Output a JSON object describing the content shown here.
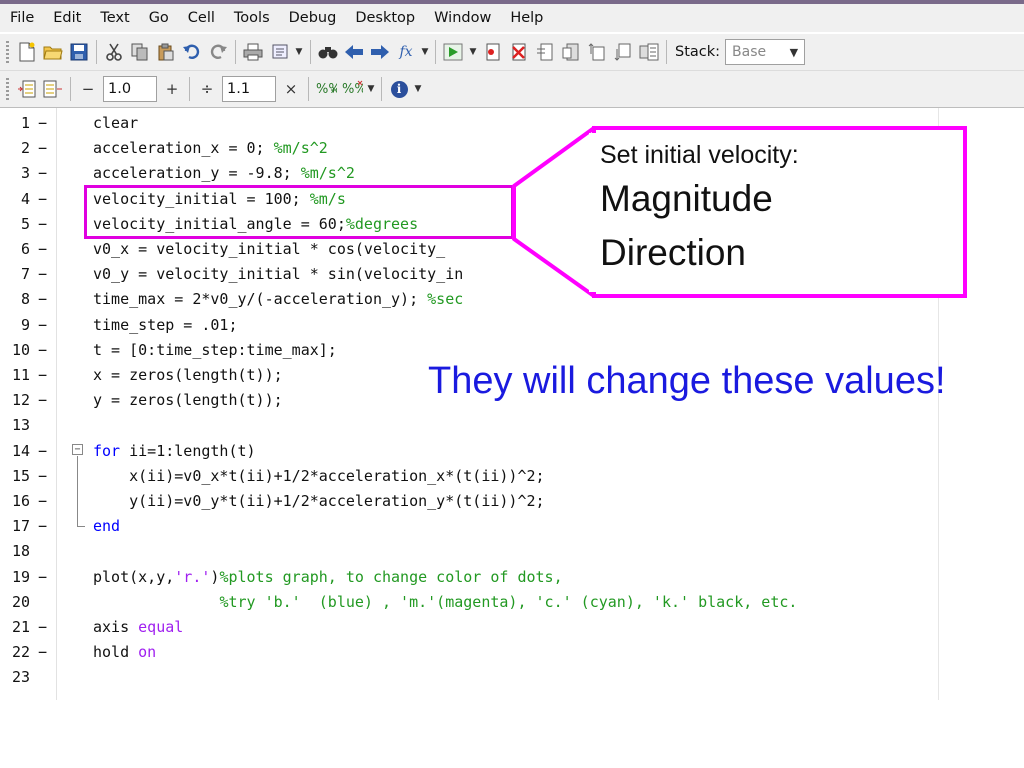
{
  "menu": [
    "File",
    "Edit",
    "Text",
    "Go",
    "Cell",
    "Tools",
    "Debug",
    "Desktop",
    "Window",
    "Help"
  ],
  "toolbar1": {
    "icons": [
      "new-file-icon",
      "open-folder-icon",
      "save-icon",
      "cut-icon",
      "copy-icon",
      "paste-icon",
      "undo-icon",
      "redo-icon",
      "print-icon",
      "comment-icon",
      "find-icon",
      "back-arrow-icon",
      "forward-arrow-icon",
      "function-icon",
      "run-icon",
      "set-breakpoint-icon",
      "clear-breakpoint-icon",
      "step-icon",
      "step-in-icon",
      "step-out-icon",
      "continue-icon",
      "exit-debug-icon"
    ],
    "function_glyph": "fx",
    "stack_label": "Stack:",
    "stack_value": "Base"
  },
  "toolbar2": {
    "minus_label": "−",
    "value1": "1.0",
    "plus_label": "+",
    "divide_label": "÷",
    "value2": "1.1",
    "times_label": "×",
    "info_label": "i"
  },
  "code_lines": [
    {
      "n": "1",
      "mark": "−",
      "parts": [
        [
          "clear",
          ""
        ]
      ]
    },
    {
      "n": "2",
      "mark": "−",
      "parts": [
        [
          "acceleration_x = 0; ",
          ""
        ],
        [
          "%m/s^2",
          "cm"
        ]
      ]
    },
    {
      "n": "3",
      "mark": "−",
      "parts": [
        [
          "acceleration_y = -9.8; ",
          ""
        ],
        [
          "%m/s^2",
          "cm"
        ]
      ]
    },
    {
      "n": "4",
      "mark": "−",
      "parts": [
        [
          "velocity_initial = 100; ",
          ""
        ],
        [
          "%m/s",
          "cm"
        ]
      ]
    },
    {
      "n": "5",
      "mark": "−",
      "parts": [
        [
          "velocity_initial_angle = 60;",
          ""
        ],
        [
          "%degrees",
          "cm"
        ]
      ]
    },
    {
      "n": "6",
      "mark": "−",
      "parts": [
        [
          "v0_x = velocity_initial * cos(velocity_",
          ""
        ]
      ]
    },
    {
      "n": "7",
      "mark": "−",
      "parts": [
        [
          "v0_y = velocity_initial * sin(velocity_in",
          ""
        ]
      ]
    },
    {
      "n": "8",
      "mark": "−",
      "parts": [
        [
          "time_max = 2*v0_y/(-acceleration_y); ",
          ""
        ],
        [
          "%sec",
          "cm"
        ]
      ]
    },
    {
      "n": "9",
      "mark": "−",
      "parts": [
        [
          "time_step = .01;",
          ""
        ]
      ]
    },
    {
      "n": "10",
      "mark": "−",
      "parts": [
        [
          "t = [0:time_step:time_max];",
          ""
        ]
      ]
    },
    {
      "n": "11",
      "mark": "−",
      "parts": [
        [
          "x = zeros(length(t));",
          ""
        ]
      ]
    },
    {
      "n": "12",
      "mark": "−",
      "parts": [
        [
          "y = zeros(length(t));",
          ""
        ]
      ]
    },
    {
      "n": "13",
      "mark": "",
      "parts": []
    },
    {
      "n": "14",
      "mark": "−",
      "parts": [
        [
          "for",
          "kw"
        ],
        [
          " ii=1:length(t)",
          ""
        ]
      ]
    },
    {
      "n": "15",
      "mark": "−",
      "parts": [
        [
          "    x(ii)=v0_x*t(ii)+1/2*acceleration_x*(t(ii))^2;",
          ""
        ]
      ]
    },
    {
      "n": "16",
      "mark": "−",
      "parts": [
        [
          "    y(ii)=v0_y*t(ii)+1/2*acceleration_y*(t(ii))^2;",
          ""
        ]
      ]
    },
    {
      "n": "17",
      "mark": "−",
      "parts": [
        [
          "end",
          "kw"
        ]
      ]
    },
    {
      "n": "18",
      "mark": "",
      "parts": []
    },
    {
      "n": "19",
      "mark": "−",
      "parts": [
        [
          "plot(x,y,",
          ""
        ],
        [
          "'r.'",
          "st"
        ],
        [
          ")",
          ""
        ],
        [
          "%plots graph, to change color of dots,",
          "cm"
        ]
      ]
    },
    {
      "n": "20",
      "mark": "",
      "parts": [
        [
          "              ",
          ""
        ],
        [
          "%try 'b.'  (blue) , 'm.'(magenta), 'c.' (cyan), 'k.' black, etc.",
          "cm"
        ]
      ]
    },
    {
      "n": "21",
      "mark": "−",
      "parts": [
        [
          "axis ",
          ""
        ],
        [
          "equal",
          "st"
        ]
      ]
    },
    {
      "n": "22",
      "mark": "−",
      "parts": [
        [
          "hold ",
          ""
        ],
        [
          "on",
          "st"
        ]
      ]
    },
    {
      "n": "23",
      "mark": "",
      "parts": []
    }
  ],
  "callout": {
    "heading": "Set initial velocity:",
    "line1": "Magnitude",
    "line2": "Direction",
    "border_color": "#ff00ff"
  },
  "note": "They will change these values!"
}
